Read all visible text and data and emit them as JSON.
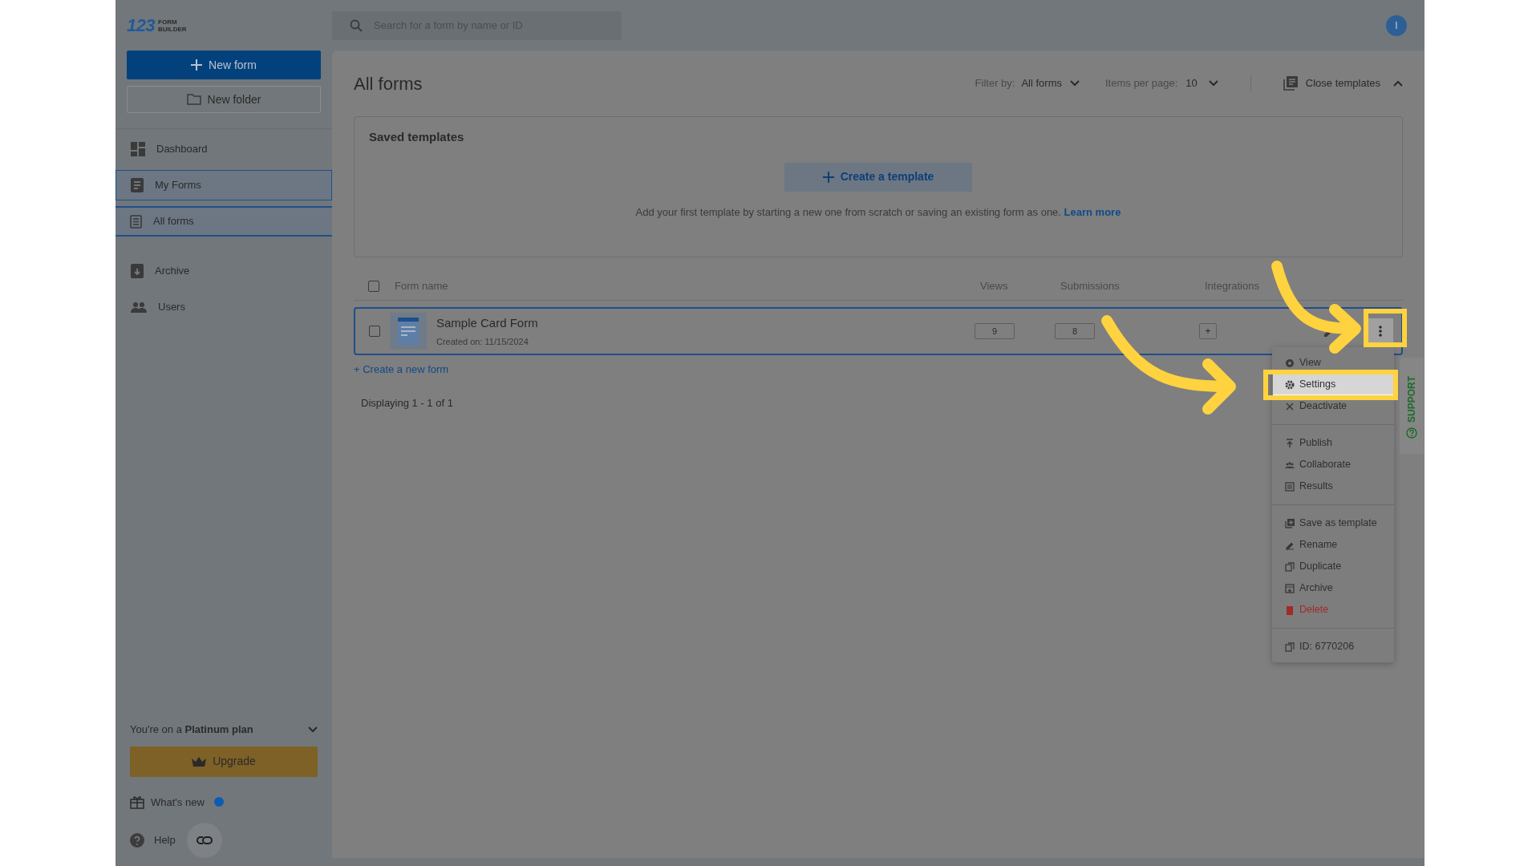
{
  "logo": {
    "digits": "123",
    "line_1": "FORM",
    "line_2": "BUILDER"
  },
  "search": {
    "placeholder": "Search for a form by name or ID"
  },
  "avatar": {
    "initial": "I"
  },
  "sidebar": {
    "new_form": "New form",
    "new_folder": "New folder",
    "items": [
      {
        "label": "Dashboard",
        "selected": false
      },
      {
        "label": "My Forms",
        "selected": true,
        "children": [
          {
            "label": "All forms",
            "selected": true
          }
        ]
      },
      {
        "label": "Archive",
        "selected": false
      },
      {
        "label": "Users",
        "selected": false
      }
    ],
    "plan": {
      "prefix": "You're on a",
      "name": "Platinum plan"
    },
    "upgrade": "Upgrade",
    "whats_new": "What's new",
    "help": "Help"
  },
  "page": {
    "title": "All forms",
    "filter_label": "Filter by:",
    "filter_value": "All forms",
    "per_page_label": "Items per page:",
    "per_page_value": "10",
    "close_templates": "Close templates"
  },
  "templates": {
    "title": "Saved templates",
    "create": "Create a template",
    "hint": "Add your first template by starting a new one from scratch or saving an existing form as one.",
    "link": "Learn more"
  },
  "table": {
    "select_all_checked": false,
    "columns": [
      "Form name",
      "Views",
      "Submissions",
      "Integrations"
    ],
    "rows": [
      {
        "name": "Sample Card Form",
        "created": "Created on: 11/15/2024",
        "views": "9",
        "submissions": "8",
        "integrations": "+",
        "checked": false
      }
    ]
  },
  "create_link": "+ Create a new form",
  "displaying": "Displaying 1 - 1 of 1",
  "menu": {
    "groups": [
      {
        "items": [
          {
            "label": "View",
            "highlighted": false,
            "danger": false
          },
          {
            "label": "Settings",
            "highlighted": true,
            "danger": false
          },
          {
            "label": "Deactivate",
            "highlighted": false,
            "danger": false
          }
        ]
      },
      {
        "items": [
          {
            "label": "Publish",
            "highlighted": false,
            "danger": false
          },
          {
            "label": "Collaborate",
            "highlighted": false,
            "danger": false
          },
          {
            "label": "Results",
            "highlighted": false,
            "danger": false
          }
        ]
      },
      {
        "items": [
          {
            "label": "Save as template",
            "highlighted": false,
            "danger": false
          },
          {
            "label": "Rename",
            "highlighted": false,
            "danger": false
          },
          {
            "label": "Duplicate",
            "highlighted": false,
            "danger": false
          },
          {
            "label": "Archive",
            "highlighted": false,
            "danger": false
          },
          {
            "label": "Delete",
            "highlighted": false,
            "danger": true
          }
        ]
      },
      {
        "items": [
          {
            "label": "ID: 6770206",
            "highlighted": false,
            "danger": false
          }
        ]
      }
    ]
  },
  "support": "SUPPORT"
}
